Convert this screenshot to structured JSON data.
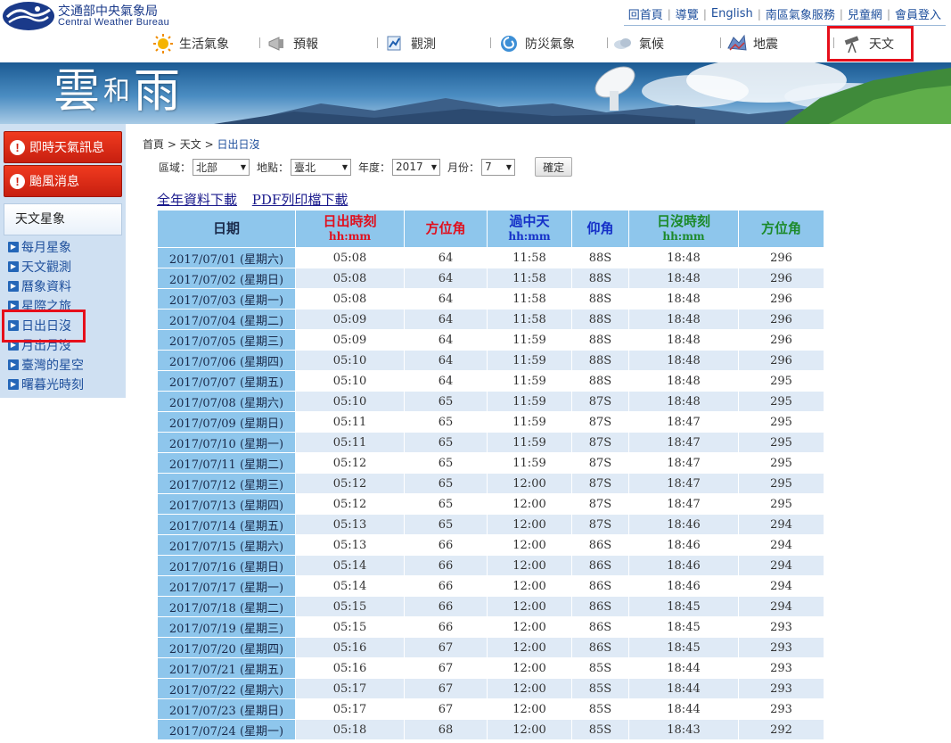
{
  "header": {
    "org_zh": "交通部中央氣象局",
    "org_en": "Central Weather Bureau",
    "toplinks": [
      "回首頁",
      "導覽",
      "English",
      "南區氣象服務",
      "兒童網",
      "會員登入"
    ]
  },
  "nav": {
    "items": [
      {
        "label": "生活氣象",
        "icon": "sun-icon"
      },
      {
        "label": "預報",
        "icon": "megaphone-icon"
      },
      {
        "label": "觀測",
        "icon": "observation-icon"
      },
      {
        "label": "防災氣象",
        "icon": "typhoon-icon"
      },
      {
        "label": "氣候",
        "icon": "climate-icon"
      },
      {
        "label": "地震",
        "icon": "earthquake-icon"
      },
      {
        "label": "天文",
        "icon": "telescope-icon"
      }
    ]
  },
  "banner": {
    "title_a": "雲",
    "title_b": "和",
    "title_c": "雨"
  },
  "sidebar": {
    "alerts": [
      "即時天氣訊息",
      "颱風消息"
    ],
    "heading": "天文星象",
    "links": [
      "每月星象",
      "天文觀測",
      "曆象資料",
      "星際之旅",
      "日出日沒",
      "月出月沒",
      "臺灣的星空",
      "曙暮光時刻"
    ]
  },
  "breadcrumb": {
    "home": "首頁",
    "section": "天文",
    "current": "日出日沒",
    "sep": ">"
  },
  "filters": {
    "region_label": "區域：",
    "region_value": "北部",
    "location_label": "地點：",
    "location_value": "臺北",
    "year_label": "年度：",
    "year_value": "2017",
    "month_label": "月份：",
    "month_value": "7",
    "confirm_label": "確定"
  },
  "downloads": {
    "year_data": "全年資料下載",
    "pdf_print": "PDF列印檔下載"
  },
  "colors": {
    "header_blue": "#8ec6ec",
    "sunrise_red": "#e0101e",
    "transit_blue": "#1530c8",
    "sunset_green": "#1c8a2a",
    "highlight_red": "#e60f1b"
  },
  "table": {
    "headers": [
      {
        "label": "日期",
        "sub": "",
        "color": "#1a2a4a"
      },
      {
        "label": "日出時刻",
        "sub": "hh:mm",
        "color": "#e0101e"
      },
      {
        "label": "方位角",
        "sub": "",
        "color": "#e0101e"
      },
      {
        "label": "過中天",
        "sub": "hh:mm",
        "color": "#1530c8"
      },
      {
        "label": "仰角",
        "sub": "",
        "color": "#1530c8"
      },
      {
        "label": "日沒時刻",
        "sub": "hh:mm",
        "color": "#1c8a2a"
      },
      {
        "label": "方位角",
        "sub": "",
        "color": "#1c8a2a"
      }
    ],
    "rows": [
      [
        "2017/07/01 (星期六)",
        "05:08",
        "64",
        "11:58",
        "88S",
        "18:48",
        "296"
      ],
      [
        "2017/07/02 (星期日)",
        "05:08",
        "64",
        "11:58",
        "88S",
        "18:48",
        "296"
      ],
      [
        "2017/07/03 (星期一)",
        "05:08",
        "64",
        "11:58",
        "88S",
        "18:48",
        "296"
      ],
      [
        "2017/07/04 (星期二)",
        "05:09",
        "64",
        "11:58",
        "88S",
        "18:48",
        "296"
      ],
      [
        "2017/07/05 (星期三)",
        "05:09",
        "64",
        "11:59",
        "88S",
        "18:48",
        "296"
      ],
      [
        "2017/07/06 (星期四)",
        "05:10",
        "64",
        "11:59",
        "88S",
        "18:48",
        "296"
      ],
      [
        "2017/07/07 (星期五)",
        "05:10",
        "64",
        "11:59",
        "88S",
        "18:48",
        "295"
      ],
      [
        "2017/07/08 (星期六)",
        "05:10",
        "65",
        "11:59",
        "87S",
        "18:48",
        "295"
      ],
      [
        "2017/07/09 (星期日)",
        "05:11",
        "65",
        "11:59",
        "87S",
        "18:47",
        "295"
      ],
      [
        "2017/07/10 (星期一)",
        "05:11",
        "65",
        "11:59",
        "87S",
        "18:47",
        "295"
      ],
      [
        "2017/07/11 (星期二)",
        "05:12",
        "65",
        "11:59",
        "87S",
        "18:47",
        "295"
      ],
      [
        "2017/07/12 (星期三)",
        "05:12",
        "65",
        "12:00",
        "87S",
        "18:47",
        "295"
      ],
      [
        "2017/07/13 (星期四)",
        "05:12",
        "65",
        "12:00",
        "87S",
        "18:47",
        "295"
      ],
      [
        "2017/07/14 (星期五)",
        "05:13",
        "65",
        "12:00",
        "87S",
        "18:46",
        "294"
      ],
      [
        "2017/07/15 (星期六)",
        "05:13",
        "66",
        "12:00",
        "86S",
        "18:46",
        "294"
      ],
      [
        "2017/07/16 (星期日)",
        "05:14",
        "66",
        "12:00",
        "86S",
        "18:46",
        "294"
      ],
      [
        "2017/07/17 (星期一)",
        "05:14",
        "66",
        "12:00",
        "86S",
        "18:46",
        "294"
      ],
      [
        "2017/07/18 (星期二)",
        "05:15",
        "66",
        "12:00",
        "86S",
        "18:45",
        "294"
      ],
      [
        "2017/07/19 (星期三)",
        "05:15",
        "66",
        "12:00",
        "86S",
        "18:45",
        "293"
      ],
      [
        "2017/07/20 (星期四)",
        "05:16",
        "67",
        "12:00",
        "86S",
        "18:45",
        "293"
      ],
      [
        "2017/07/21 (星期五)",
        "05:16",
        "67",
        "12:00",
        "85S",
        "18:44",
        "293"
      ],
      [
        "2017/07/22 (星期六)",
        "05:17",
        "67",
        "12:00",
        "85S",
        "18:44",
        "293"
      ],
      [
        "2017/07/23 (星期日)",
        "05:17",
        "67",
        "12:00",
        "85S",
        "18:44",
        "293"
      ],
      [
        "2017/07/24 (星期一)",
        "05:18",
        "68",
        "12:00",
        "85S",
        "18:43",
        "292"
      ]
    ]
  }
}
